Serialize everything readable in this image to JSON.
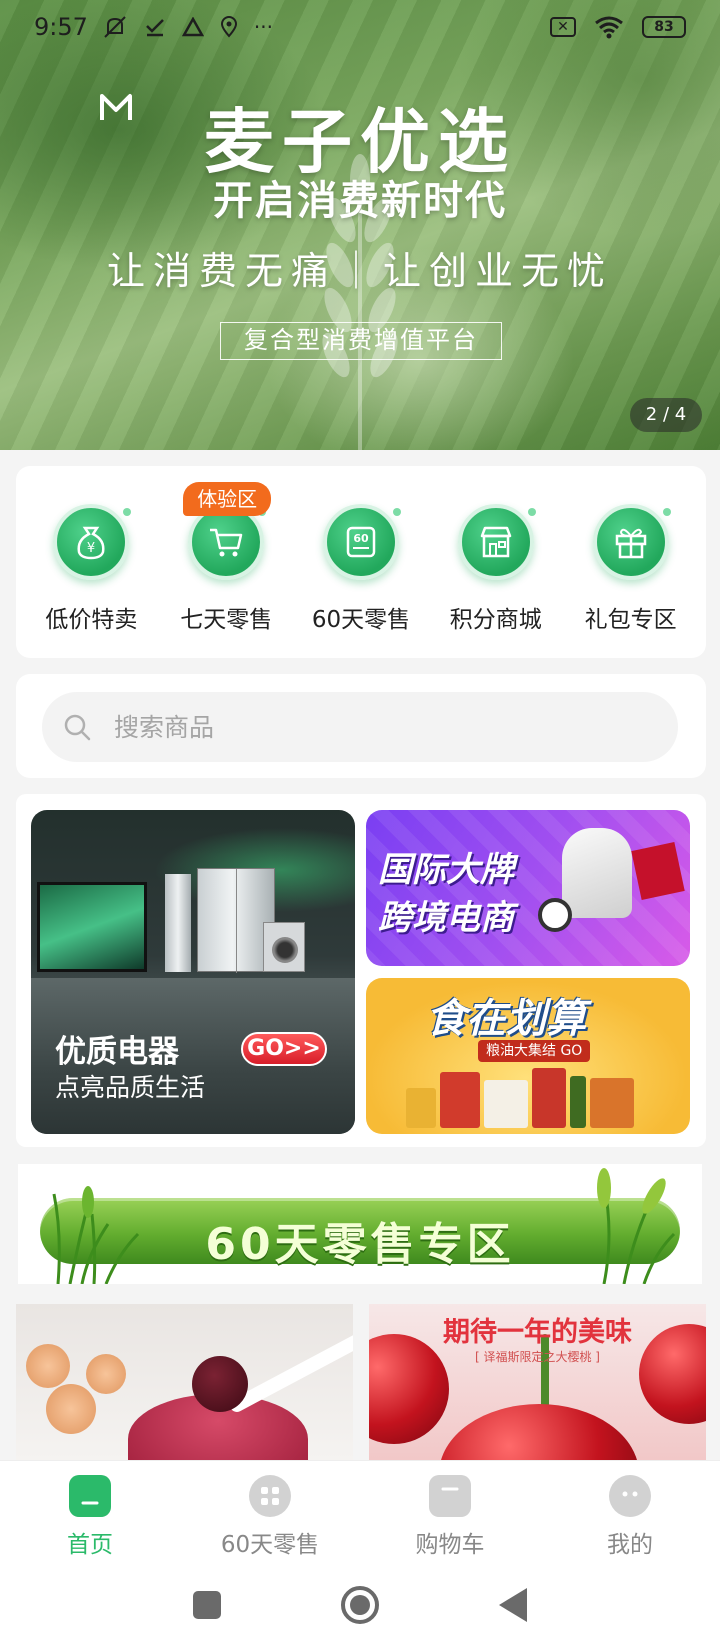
{
  "status_bar": {
    "time": "9:57",
    "battery": "83",
    "icons": [
      "mute-icon",
      "check-icon",
      "drive-icon",
      "location-icon",
      "more-icon",
      "no-sim-icon",
      "wifi-icon",
      "battery-icon"
    ],
    "more": "···"
  },
  "hero": {
    "title": "麦子优选",
    "subtitle": "开启消费新时代",
    "tagline": "让消费无痛｜让创业无忧",
    "badge": "复合型消费增值平台",
    "pager": "2 / 4"
  },
  "categories": {
    "items": [
      {
        "label": "低价特卖",
        "icon": "money-bag-icon"
      },
      {
        "label": "七天零售",
        "icon": "cart-icon",
        "tag": "体验区"
      },
      {
        "label": "60天零售",
        "icon": "60-calendar-icon"
      },
      {
        "label": "积分商城",
        "icon": "store-icon"
      },
      {
        "label": "礼包专区",
        "icon": "gift-icon"
      }
    ]
  },
  "search": {
    "placeholder": "搜索商品"
  },
  "promos": {
    "appliances_title": "优质电器",
    "appliances_subtitle": "点亮品质生活",
    "appliances_cta": "GO>>",
    "crossborder_text_line1": "国际大牌",
    "crossborder_text_line2": "跨境电商",
    "food_title": "食在划算",
    "food_ribbon": "粮油大集结 GO"
  },
  "zone_banner": {
    "title": "60天零售专区"
  },
  "products": {
    "right_title": "期待一年的美味",
    "right_subtitle": "[ 译福斯限定之大樱桃 ]"
  },
  "bottom_nav": {
    "items": [
      {
        "label": "首页",
        "icon": "home-icon",
        "active": true
      },
      {
        "label": "60天零售",
        "icon": "grid-icon",
        "active": false
      },
      {
        "label": "购物车",
        "icon": "bag-icon",
        "active": false
      },
      {
        "label": "我的",
        "icon": "user-icon",
        "active": false
      }
    ]
  },
  "colors": {
    "accent": "#2bba6a",
    "tag": "#f26b1d",
    "nav_inactive": "#888888"
  }
}
